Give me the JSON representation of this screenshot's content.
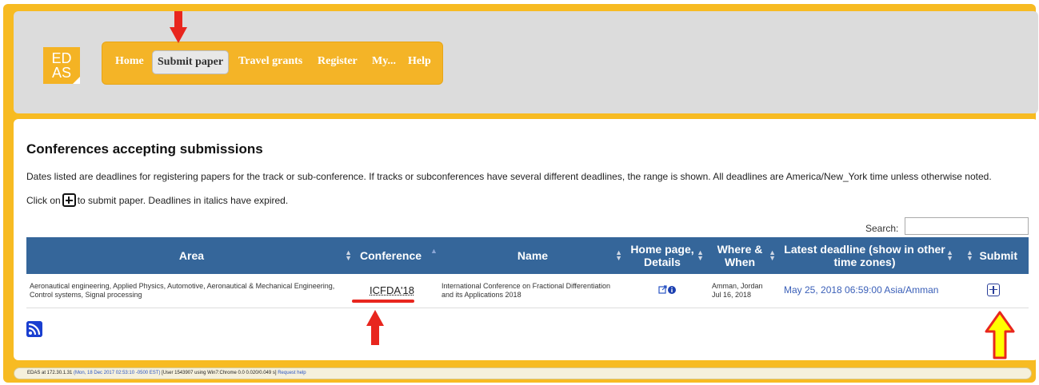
{
  "logo": {
    "line1": "ED",
    "line2": "AS"
  },
  "nav": {
    "items": [
      {
        "label": "Home"
      },
      {
        "label": "Submit paper"
      },
      {
        "label": "Travel grants"
      },
      {
        "label": "Register"
      },
      {
        "label": "My..."
      },
      {
        "label": "Help"
      }
    ],
    "active": "Submit paper"
  },
  "main": {
    "title": "Conferences accepting submissions",
    "description": "Dates listed are deadlines for registering papers for the track or sub-conference. If tracks or subconferences have several different deadlines, the range is shown. All deadlines are America/New_York time unless otherwise noted.",
    "click_prefix": "Click on",
    "click_suffix": "to submit paper. Deadlines in italics have expired.",
    "search_label": "Search:",
    "search_value": ""
  },
  "table": {
    "headers": [
      "Area",
      "Conference",
      "Name",
      "Home page, Details",
      "Where & When",
      "Latest deadline (show in other time zones)",
      "Submit"
    ],
    "rows": [
      {
        "area": "Aeronautical engineering, Applied Physics, Automotive, Aeronautical & Mechanical Engineering, Control systems, Signal processing",
        "conference": "ICFDA'18",
        "name": "International Conference on Fractional Differentiation and its Applications 2018",
        "where": "Amman, Jordan",
        "when": "Jul 16, 2018",
        "deadline": "May 25, 2018 06:59:00 Asia/Amman"
      }
    ]
  },
  "footer": {
    "prefix": "EDAS at 172.30.1.31",
    "timestamp": "(Mon, 18 Dec 2017 02:53:10 -0500 EST)",
    "user_info": "[User 1543907 using Win7:Chrome 0.0 0.020/0.049 s]",
    "help": "Request help"
  },
  "colors": {
    "frame": "#f7bb22",
    "table_header": "#35669a",
    "deadline_link": "#3a5fb8",
    "annotation_red": "#e8261e",
    "annotation_yellow": "#ffff00"
  }
}
